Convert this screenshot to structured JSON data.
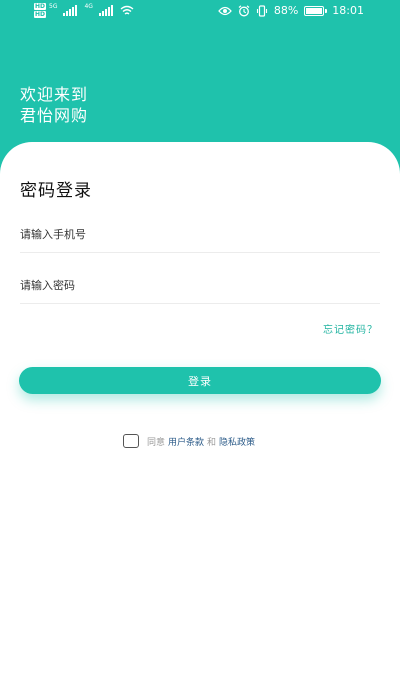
{
  "statusbar": {
    "net_badges": [
      "HD",
      "HD"
    ],
    "net_5g": "5G",
    "net_4g": "4G",
    "battery_percent": "88%",
    "battery_level": 0.88,
    "time": "18:01",
    "icons": [
      "signal-icon",
      "wifi-icon",
      "eye-icon",
      "alarm-icon",
      "vibrate-icon",
      "battery-icon"
    ]
  },
  "header": {
    "line1": "欢迎来到",
    "line2": "君怡网购",
    "bg_color": "#1fc2ac"
  },
  "login": {
    "title": "密码登录",
    "phone_placeholder": "请输入手机号",
    "password_placeholder": "请输入密码",
    "forgot_label": "忘记密码？",
    "submit_label": "登录"
  },
  "agreement": {
    "prefix": "同意",
    "terms_label": "用户条款",
    "and": "和",
    "privacy_label": "隐私政策",
    "checked": false
  },
  "colors": {
    "accent": "#1fc2ac",
    "link": "#2e5d8a",
    "forgot": "#1fb3a0"
  }
}
